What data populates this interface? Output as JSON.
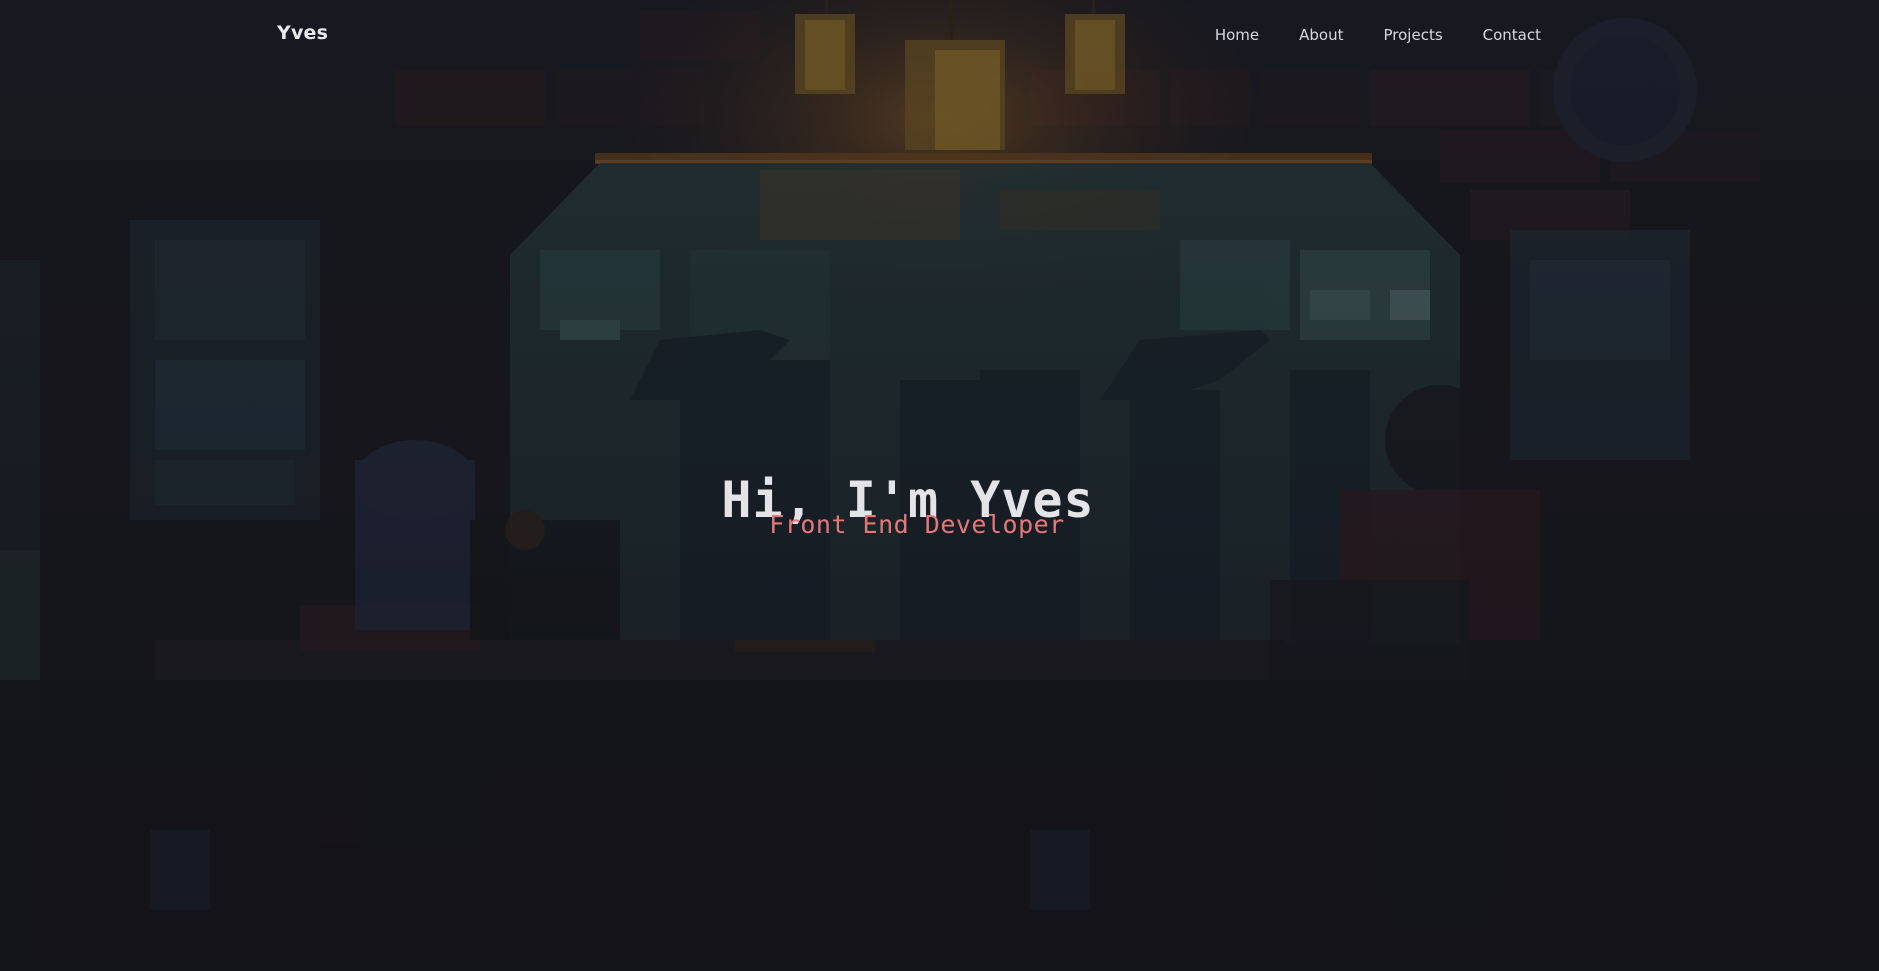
{
  "nav": {
    "brand": "Yves",
    "links": [
      {
        "label": "Home"
      },
      {
        "label": "About"
      },
      {
        "label": "Projects"
      },
      {
        "label": "Contact"
      }
    ]
  },
  "hero": {
    "title": "Hi, I'm Yves",
    "subtitle": "Front End Developer"
  },
  "colors": {
    "background": "#18191f",
    "title": "#e3e3e8",
    "subtitle_accent": "#e6787a",
    "lamp_glow": "#b8772a"
  },
  "background_image": "pixel-art-cafe-scene"
}
